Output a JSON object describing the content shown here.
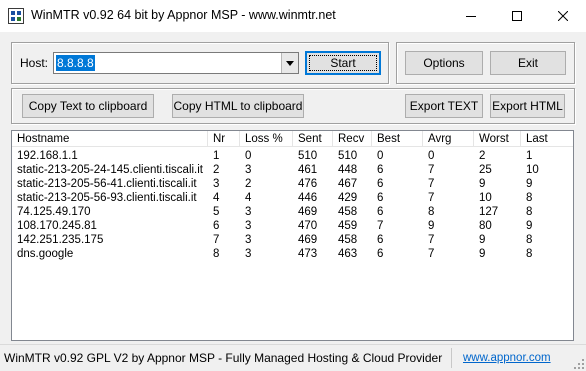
{
  "window": {
    "title": "WinMTR v0.92 64 bit by Appnor MSP - www.winmtr.net",
    "icon": "winmtr-app-icon",
    "controls": [
      "minimize-icon",
      "maximize-icon",
      "close-icon"
    ]
  },
  "host": {
    "label": "Host:",
    "value": "8.8.8.8"
  },
  "buttons": {
    "start": "Start",
    "options": "Options",
    "exit": "Exit",
    "copy_text": "Copy Text to clipboard",
    "copy_html": "Copy HTML to clipboard",
    "export_text": "Export TEXT",
    "export_html": "Export HTML"
  },
  "table": {
    "columns": [
      "Hostname",
      "Nr",
      "Loss %",
      "Sent",
      "Recv",
      "Best",
      "Avrg",
      "Worst",
      "Last"
    ],
    "rows": [
      [
        "192.168.1.1",
        "1",
        "0",
        "510",
        "510",
        "0",
        "0",
        "2",
        "1"
      ],
      [
        "static-213-205-24-145.clienti.tiscali.it",
        "2",
        "3",
        "461",
        "448",
        "6",
        "7",
        "25",
        "10"
      ],
      [
        "static-213-205-56-41.clienti.tiscali.it",
        "3",
        "2",
        "476",
        "467",
        "6",
        "7",
        "9",
        "9"
      ],
      [
        "static-213-205-56-93.clienti.tiscali.it",
        "4",
        "4",
        "446",
        "429",
        "6",
        "7",
        "10",
        "8"
      ],
      [
        "74.125.49.170",
        "5",
        "3",
        "469",
        "458",
        "6",
        "8",
        "127",
        "8"
      ],
      [
        "108.170.245.81",
        "6",
        "3",
        "470",
        "459",
        "7",
        "9",
        "80",
        "9"
      ],
      [
        "142.251.235.175",
        "7",
        "3",
        "469",
        "458",
        "6",
        "7",
        "9",
        "8"
      ],
      [
        "dns.google",
        "8",
        "3",
        "473",
        "463",
        "6",
        "7",
        "9",
        "8"
      ]
    ]
  },
  "status": {
    "text": "WinMTR v0.92 GPL V2 by Appnor MSP - Fully Managed Hosting & Cloud Provider",
    "link": "www.appnor.com"
  },
  "colors": {
    "selection": "#0078d7",
    "link": "#0066cc",
    "dialog_bg": "#f0f0f0"
  }
}
